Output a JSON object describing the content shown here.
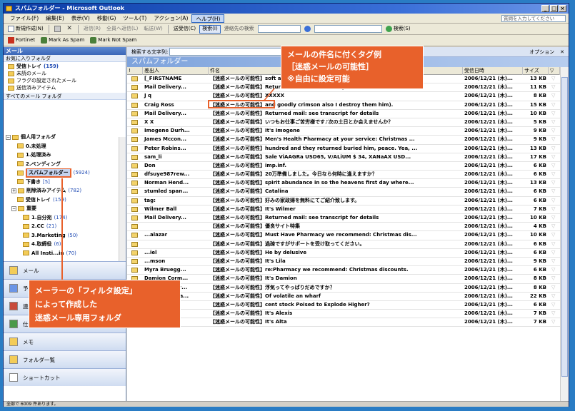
{
  "window": {
    "title": "スパムフォルダー - Microsoft Outlook",
    "controls": [
      "_",
      "□",
      "×"
    ]
  },
  "menu": {
    "items": [
      "ファイル(F)",
      "編集(E)",
      "表示(V)",
      "移動(G)",
      "ツール(T)",
      "アクション(A)",
      "ヘルプ(H)"
    ],
    "help_query_placeholder": "質問を入力してください"
  },
  "toolbar1": {
    "new": "新規作成(N)",
    "reply": "返信(R)",
    "reply_all": "全員へ返信(L)",
    "forward": "転送(W)",
    "send_receive": "送受信(C)",
    "find": "検索(I)",
    "address_label": "連絡先の検索",
    "search_button": "検索(S)"
  },
  "toolbar2": {
    "fortinet": "Fortinet",
    "mark_as_spam": "Mark As Spam",
    "mark_not_spam": "Mark Not Spam"
  },
  "nav": {
    "header": "メール",
    "favorites_label": "お気に入りフォルダ",
    "favorites": [
      {
        "label": "受信トレイ",
        "count": "(159)",
        "bold": true
      },
      {
        "label": "未読のメール",
        "count": "",
        "bold": false
      },
      {
        "label": "フラグの設定されたメール",
        "count": "",
        "bold": false
      },
      {
        "label": "送信済みアイテム",
        "count": "",
        "bold": false
      }
    ],
    "all_folders_label": "すべてのメール フォルダ",
    "tree": [
      {
        "label": "個人用フォルダ",
        "count": "",
        "indent": 0,
        "exp": "−"
      },
      {
        "label": "0.未処理",
        "count": "",
        "indent": 2,
        "exp": ""
      },
      {
        "label": "1.処理済み",
        "count": "",
        "indent": 2,
        "exp": ""
      },
      {
        "label": "2.ペンディング",
        "count": "",
        "indent": 2,
        "exp": ""
      },
      {
        "label": "スパムフォルダー",
        "count": "(5924)",
        "indent": 2,
        "exp": "",
        "selected": true
      },
      {
        "label": "下書き",
        "count": "[5]",
        "indent": 2,
        "exp": ""
      },
      {
        "label": "削除済みアイテム",
        "count": "(782)",
        "indent": 1,
        "exp": "+"
      },
      {
        "label": "受信トレイ",
        "count": "(159)",
        "indent": 2,
        "exp": ""
      },
      {
        "label": "重要",
        "count": "",
        "indent": 1,
        "exp": "−"
      },
      {
        "label": "1.自分宛",
        "count": "(174)",
        "indent": 3,
        "exp": ""
      },
      {
        "label": "2.CC",
        "count": "(21)",
        "indent": 3,
        "exp": ""
      },
      {
        "label": "3.Marketing",
        "count": "(50)",
        "indent": 3,
        "exp": ""
      },
      {
        "label": "4.取締役",
        "count": "(6)",
        "indent": 3,
        "exp": ""
      },
      {
        "label": "All Insti...in",
        "count": "(70)",
        "indent": 3,
        "exp": ""
      }
    ],
    "modes": [
      "メール",
      "予定表",
      "連絡先",
      "仕事",
      "メモ",
      "フォルダ一覧",
      "ショートカット"
    ]
  },
  "search": {
    "label": "検索する文字列:",
    "value": "",
    "options": "オプション"
  },
  "folder_title": "スパムフォルダー",
  "columns": {
    "flags": "!",
    "from": "差出人",
    "subject": "件名",
    "received": "受信日時",
    "size": "サイズ",
    "flag": "▽"
  },
  "rows": [
    {
      "from": "[_FIRSTNAME",
      "tag": "【迷惑メールの可能性】",
      "subject": "soft at incredibly low pricesby",
      "date": "2006/12/21 (木)...",
      "size": "13 KB"
    },
    {
      "from": "Mail Delivery...",
      "tag": "【迷惑メールの可能性】",
      "subject": "Returned mail: see transcript for details",
      "date": "2006/12/21 (木)...",
      "size": "11 KB"
    },
    {
      "from": "J q",
      "tag": "【迷惑メールの可能性】",
      "subject": "XXXXX",
      "date": "2006/12/21 (木)...",
      "size": "8 KB"
    },
    {
      "from": "Craig Ross",
      "tag": "【迷惑メールの可能性】",
      "subject": "and goodly crimson also I destroy them him).",
      "date": "2006/12/21 (木)...",
      "size": "15 KB"
    },
    {
      "from": "Mail Delivery...",
      "tag": "【迷惑メールの可能性】",
      "subject": "Returned mail: see transcript for details",
      "date": "2006/12/21 (木)...",
      "size": "10 KB"
    },
    {
      "from": "X X",
      "tag": "【迷惑メールの可能性】",
      "subject": "いつもお仕事ご苦労様です♪次の土日とか会えませんか？",
      "date": "2006/12/21 (木)...",
      "size": "5 KB"
    },
    {
      "from": "Imogene Durh...",
      "tag": "【迷惑メールの可能性】",
      "subject": "It's Imogene",
      "date": "2006/12/21 (木)...",
      "size": "9 KB"
    },
    {
      "from": "James Mccon...",
      "tag": "【迷惑メールの可能性】",
      "subject": "Men's Health Pharmacy at your service: Christmas ...",
      "date": "2006/12/21 (木)...",
      "size": "9 KB"
    },
    {
      "from": "Peter Robins...",
      "tag": "【迷惑メールの可能性】",
      "subject": "hundred and they returned buried him, peace. Yea, ...",
      "date": "2006/12/21 (木)...",
      "size": "13 KB"
    },
    {
      "from": "sam_li",
      "tag": "【迷惑メールの可能性】",
      "subject": "Sale ViAAGRa USD65, V/ALiUM $ 34, XANaAX USD...",
      "date": "2006/12/21 (木)...",
      "size": "17 KB"
    },
    {
      "from": "Don",
      "tag": "【迷惑メールの可能性】",
      "subject": "imp.inf.",
      "date": "2006/12/21 (木)...",
      "size": "6 KB"
    },
    {
      "from": "dfsuye987rew...",
      "tag": "【迷惑メールの可能性】",
      "subject": "20万準備しました。今日なら何時に逢えますか？",
      "date": "2006/12/21 (木)...",
      "size": "6 KB"
    },
    {
      "from": "Norman Hend...",
      "tag": "【迷惑メールの可能性】",
      "subject": "spirit abundance in so the heavens first day where...",
      "date": "2006/12/21 (木)...",
      "size": "13 KB"
    },
    {
      "from": "stumled span...",
      "tag": "【迷惑メールの可能性】",
      "subject": "Catalina",
      "date": "2006/12/21 (木)...",
      "size": "6 KB"
    },
    {
      "from": "tag:",
      "tag": "【迷惑メールの可能性】",
      "subject": "好みの家政婦を無料にてご紹介致します。",
      "date": "2006/12/21 (木)...",
      "size": "6 KB"
    },
    {
      "from": "Wilmer Ball",
      "tag": "【迷惑メールの可能性】",
      "subject": "It's Wilmer",
      "date": "2006/12/21 (木)...",
      "size": "7 KB"
    },
    {
      "from": "Mail Delivery...",
      "tag": "【迷惑メールの可能性】",
      "subject": "Returned mail: see transcript for details",
      "date": "2006/12/21 (木)...",
      "size": "10 KB"
    },
    {
      "from": "",
      "tag": "【迷惑メールの可能性】",
      "subject": "優良サイト特集",
      "date": "2006/12/21 (木)...",
      "size": "4 KB"
    },
    {
      "from": "...alazar",
      "tag": "【迷惑メールの可能性】",
      "subject": "Must Have Pharmacy we recommend: Christmas dis...",
      "date": "2006/12/21 (木)...",
      "size": "10 KB"
    },
    {
      "from": "",
      "tag": "【迷惑メールの可能性】",
      "subject": "過疎ですがサポートを受け取ってください。",
      "date": "2006/12/21 (木)...",
      "size": "6 KB"
    },
    {
      "from": "...iel",
      "tag": "【迷惑メールの可能性】",
      "subject": "He by delusive",
      "date": "2006/12/21 (木)...",
      "size": "6 KB"
    },
    {
      "from": "...mson",
      "tag": "【迷惑メールの可能性】",
      "subject": "It's Lila",
      "date": "2006/12/21 (木)...",
      "size": "9 KB"
    },
    {
      "from": "Myra Bruegg...",
      "tag": "【迷惑メールの可能性】",
      "subject": "re:Pharmacy we recommend: Christmas discounts.",
      "date": "2006/12/21 (木)...",
      "size": "6 KB"
    },
    {
      "from": "Damion Corm...",
      "tag": "【迷惑メールの可能性】",
      "subject": "It's Damion",
      "date": "2006/12/21 (木)...",
      "size": "8 KB"
    },
    {
      "from": "dg98asdf4a#...",
      "tag": "【迷惑メールの可能性】",
      "subject": "浮気ってやっぱりだめですか？",
      "date": "2006/12/21 (木)...",
      "size": "8 KB"
    },
    {
      "from": "Adrian Mayna...",
      "tag": "【迷惑メールの可能性】",
      "subject": "Of volatile an wharf",
      "date": "2006/12/21 (木)...",
      "size": "22 KB"
    },
    {
      "from": "Jon Oodkj",
      "tag": "【迷惑メールの可能性】",
      "subject": "cent stock Poised to Explode Higher?",
      "date": "2006/12/21 (木)...",
      "size": "6 KB"
    },
    {
      "from": "Alexis Hines",
      "tag": "【迷惑メールの可能性】",
      "subject": "It's Alexis",
      "date": "2006/12/21 (木)...",
      "size": "7 KB"
    },
    {
      "from": "Alta Gibbs",
      "tag": "【迷惑メールの可能性】",
      "subject": "It's Alta",
      "date": "2006/12/21 (木)...",
      "size": "7 KB"
    }
  ],
  "status": "全部で 6009 件あります。",
  "callouts": {
    "tag_note": [
      "メールの件名に付くタグ例",
      "［迷惑メールの可能性］",
      "※自由に設定可能"
    ],
    "folder_note": [
      "メーラーの「フィルタ設定」",
      "によって作成した",
      "迷惑メール専用フォルダ"
    ]
  },
  "colors": {
    "accent": "#e8612b",
    "background": "#2a7cc4"
  }
}
